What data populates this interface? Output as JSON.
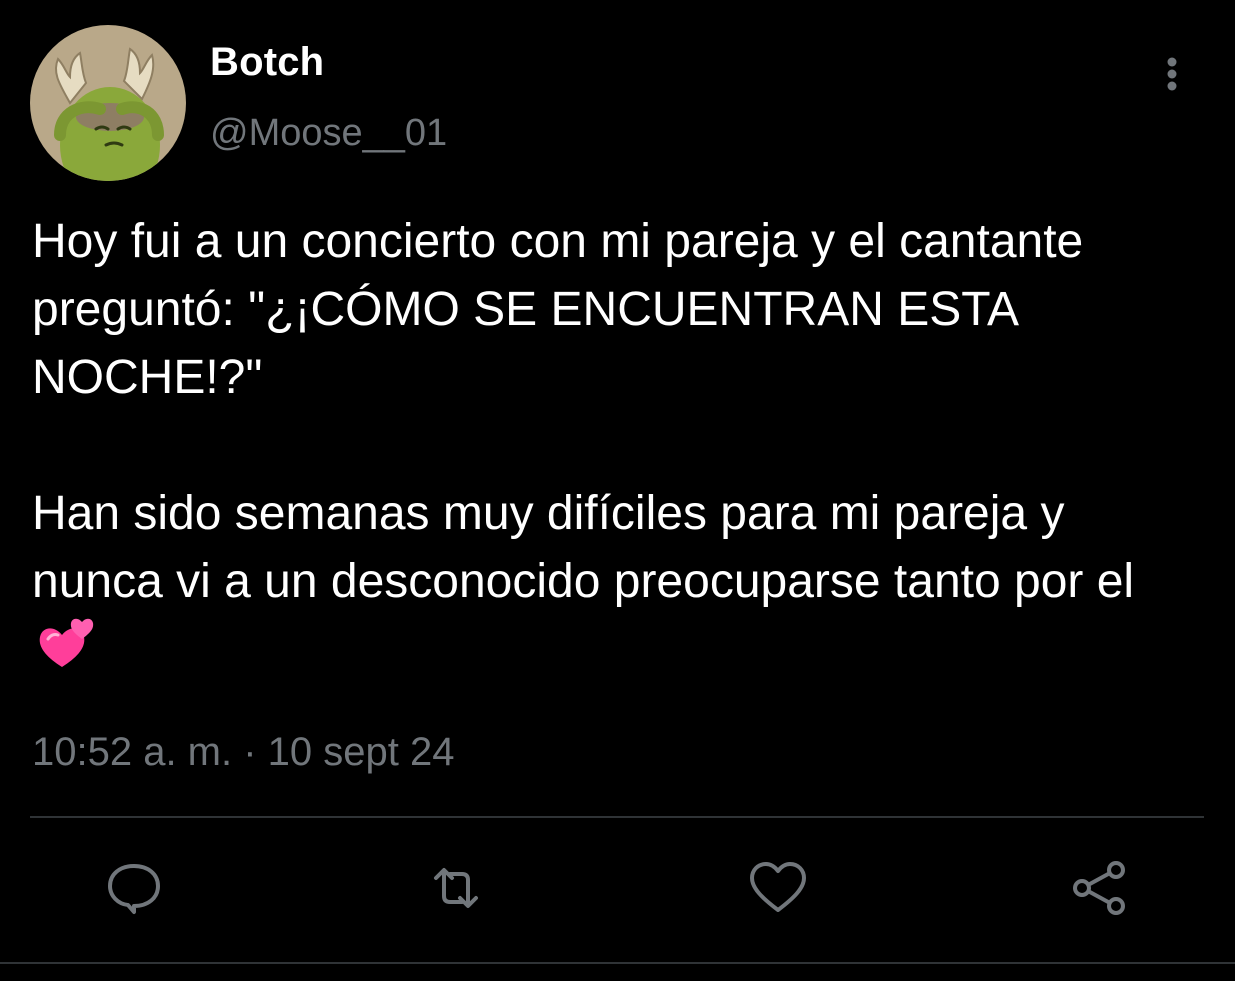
{
  "user": {
    "display_name": "Botch",
    "handle": "@Moose__01",
    "avatar_icon": "moose-cartoon-avatar"
  },
  "tweet": {
    "paragraph_1": "Hoy fui a un concierto con mi pareja y el cantante preguntó: \"¿¡CÓMO SE ENCUENTRAN ESTA NOCHE!?\"",
    "paragraph_2": "Han sido semanas muy difíciles para mi pareja y nunca vi a un desconocido preocuparse tanto por el",
    "emoji": "two-hearts-emoji",
    "time": "10:52 a. m.",
    "separator": " · ",
    "date": "10 sept 24"
  },
  "actions": {
    "reply_icon": "reply-icon",
    "retweet_icon": "retweet-icon",
    "like_icon": "heart-icon",
    "share_icon": "share-icon",
    "more_icon": "more-options-icon"
  },
  "colors": {
    "background": "#000000",
    "text_primary": "#ffffff",
    "text_secondary": "#71767b",
    "divider": "#2f3336",
    "icon": "#71767b",
    "emoji_pink": "#ff4fa3"
  }
}
